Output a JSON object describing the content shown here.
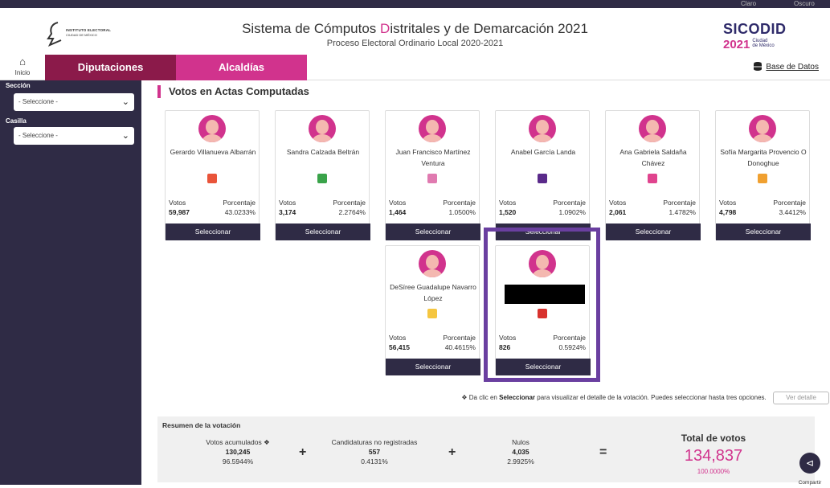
{
  "colors": {
    "primary_dark": "#2f2b45",
    "accent_pink": "#d1338d",
    "maroon": "#8b1a4a",
    "highlight": "#6a3fa0"
  },
  "topstrip": {
    "theme_light": "Claro",
    "theme_dark": "Oscuro"
  },
  "header": {
    "logo_line1": "INSTITUTO ELECTORAL",
    "logo_line2": "CIUDAD DE MÉXICO",
    "title_before": "Sistema de Cómputos ",
    "title_highlight": "D",
    "title_after": "istritales y de Demarcación 2021",
    "subtitle": "Proceso Electoral Ordinario Local 2020-2021",
    "brand_name": "SICODID",
    "brand_year": "2021",
    "brand_city_1": "Ciudad",
    "brand_city_2": "de México"
  },
  "nav": {
    "home_label": "Inicio",
    "tab_diputaciones": "Diputaciones",
    "tab_alcaldias": "Alcaldías",
    "db_link": "Base de Datos"
  },
  "sidebar": {
    "seccion_label": "Sección",
    "seccion_value": "- Seleccione -",
    "casilla_label": "Casilla",
    "casilla_value": "- Seleccione -"
  },
  "section_title": "Votos en Actas Computadas",
  "labels": {
    "votos": "Votos",
    "porcentaje": "Porcentaje",
    "seleccionar": "Seleccionar"
  },
  "candidates": [
    {
      "name": "Gerardo Villanueva Albarrán",
      "votes": "59,987",
      "pct": "43.0233%",
      "party_icon": "pri-logo-icon",
      "party_color": "#e9543a"
    },
    {
      "name": "Sandra Calzada Beltrán",
      "votes": "3,174",
      "pct": "2.2764%",
      "party_icon": "pvem-logo-icon",
      "party_color": "#3aa34a"
    },
    {
      "name": "Juan Francisco Martínez Ventura",
      "votes": "1,464",
      "pct": "1.0500%",
      "party_icon": "pt-logo-icon",
      "party_color": "#e07ab0"
    },
    {
      "name": "Anabel García Landa",
      "votes": "1,520",
      "pct": "1.0902%",
      "party_icon": "pes-logo-icon",
      "party_color": "#5a2a8a"
    },
    {
      "name": "Ana Gabriela Saldaña Chávez",
      "votes": "2,061",
      "pct": "1.4782%",
      "party_icon": "rsp-logo-icon",
      "party_color": "#e0448e"
    },
    {
      "name": "Sofía Margarita Provencio O Donoghue",
      "votes": "4,798",
      "pct": "3.4412%",
      "party_icon": "fxm-logo-icon",
      "party_color": "#f0a030"
    },
    {
      "name": "DeSíree Guadalupe Navarro López",
      "votes": "56,415",
      "pct": "40.4615%",
      "party_icon": "coalicion-logo-icon",
      "party_color": "#f5c640"
    },
    {
      "name": "",
      "votes": "826",
      "pct": "0.5924%",
      "party_icon": "morena-ind-logo-icon",
      "party_color": "#d8322e"
    }
  ],
  "info_text_before": "Da clic en ",
  "info_text_bold": "Seleccionar",
  "info_text_after": " para visualizar el detalle de la votación. Puedes seleccionar hasta tres opciones.",
  "info_button": "Ver detalle",
  "summary": {
    "title": "Resumen de la votación",
    "acumulados_label": "Votos acumulados",
    "acumulados_value": "130,245",
    "acumulados_pct": "96.5944%",
    "no_registradas_label": "Candidaturas no registradas",
    "no_registradas_value": "557",
    "no_registradas_pct": "0.4131%",
    "nulos_label": "Nulos",
    "nulos_value": "4,035",
    "nulos_pct": "2.9925%",
    "total_label": "Total de votos",
    "total_value": "134,837",
    "total_pct": "100.0000%"
  },
  "share_label": "Compartir"
}
